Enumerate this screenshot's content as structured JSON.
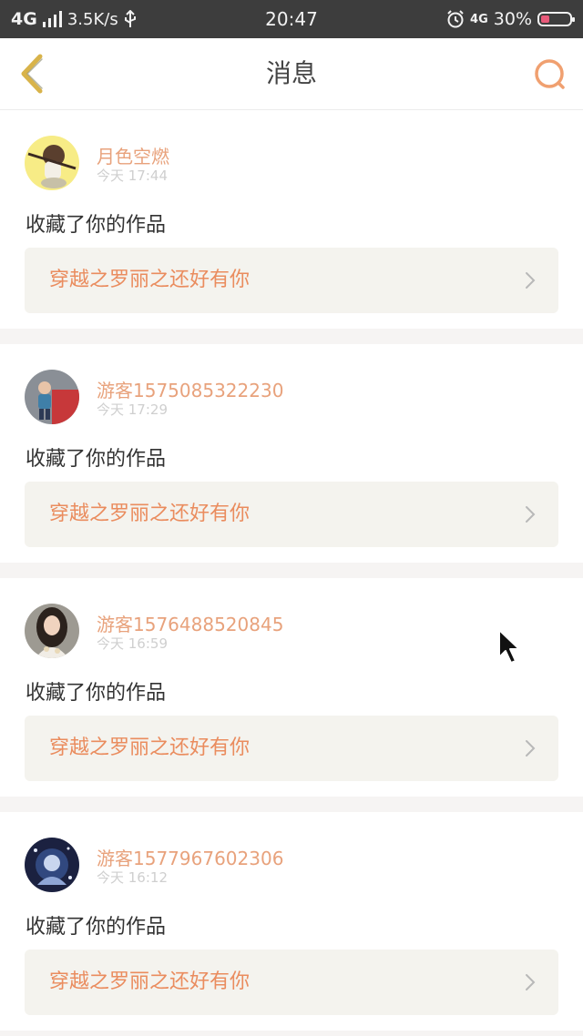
{
  "status_bar": {
    "network": "4G",
    "speed": "3.5K/s",
    "time": "20:47",
    "network_right": "4G",
    "battery": "30%",
    "battery_level": 0.3
  },
  "header": {
    "title": "消息",
    "back_icon": "chevron-left-icon",
    "search_icon": "search-icon"
  },
  "messages": [
    {
      "user": "月色空燃",
      "time": "今天 17:44",
      "action": "收藏了你的作品",
      "work": "穿越之罗丽之还好有你"
    },
    {
      "user": "游客1575085322230",
      "time": "今天 17:29",
      "action": "收藏了你的作品",
      "work": "穿越之罗丽之还好有你"
    },
    {
      "user": "游客1576488520845",
      "time": "今天 16:59",
      "action": "收藏了你的作品",
      "work": "穿越之罗丽之还好有你"
    },
    {
      "user": "游客1577967602306",
      "time": "今天 16:12",
      "action": "收藏了你的作品",
      "work": "穿越之罗丽之还好有你"
    }
  ],
  "colors": {
    "accent": "#ea8c5e",
    "username": "#e8a27c",
    "back_icon": "#d8b34a",
    "search_icon": "#f0a070"
  }
}
